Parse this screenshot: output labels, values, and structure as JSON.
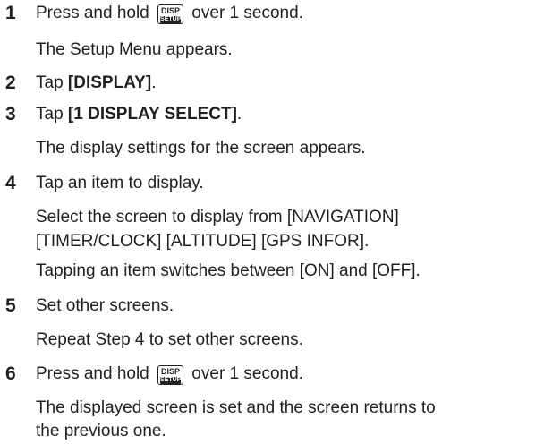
{
  "key_icon": {
    "top": "DISP",
    "bottom": "SETUP"
  },
  "steps": [
    {
      "number": "1",
      "instruction": {
        "pre": "Press and hold",
        "post": "over 1 second."
      },
      "details": [
        "The Setup Menu appears."
      ]
    },
    {
      "number": "2",
      "instruction": {
        "pre": "Tap",
        "bold": "[DISPLAY]",
        "post": "."
      },
      "details": []
    },
    {
      "number": "3",
      "instruction": {
        "pre": "Tap",
        "bold": "[1 DISPLAY SELECT]",
        "post": "."
      },
      "details": [
        "The display settings for the screen appears."
      ]
    },
    {
      "number": "4",
      "instruction": {
        "text": "Tap an item to display."
      },
      "details": [
        "Select the screen to display from [NAVIGATION]",
        "[TIMER/CLOCK] [ALTITUDE] [GPS INFOR].",
        "Tapping an item switches between [ON] and [OFF]."
      ]
    },
    {
      "number": "5",
      "instruction": {
        "text": "Set other screens."
      },
      "details": [
        "Repeat Step 4 to set other screens."
      ]
    },
    {
      "number": "6",
      "instruction": {
        "pre": "Press and hold",
        "post": "over 1 second."
      },
      "details": [
        "The displayed screen is set and the screen returns to",
        "the previous one."
      ]
    }
  ]
}
